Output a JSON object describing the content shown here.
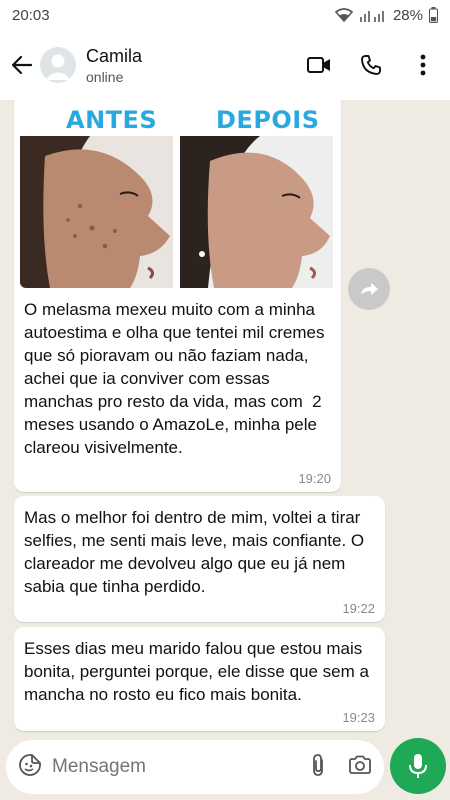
{
  "status_bar": {
    "time": "20:03",
    "battery": "28%"
  },
  "header": {
    "contact_name": "Camila",
    "contact_status": "online"
  },
  "messages": [
    {
      "type": "image",
      "image_labels": {
        "before": "ANTES",
        "after": "DEPOIS"
      },
      "caption": "O melasma mexeu muito com a minha autoestima e olha que tentei mil cremes que só pioravam ou não faziam nada, achei que ia conviver com essas manchas pro resto da vida, mas com  2 meses usando o AmazoLe, minha pele clareou visivelmente.",
      "time": "19:20"
    },
    {
      "type": "text",
      "text": "Mas o melhor foi dentro de mim, voltei a tirar selfies, me senti mais leve, mais confiante. O clareador me devolveu algo que eu já nem sabia que tinha perdido.",
      "time": "19:22"
    },
    {
      "type": "text",
      "text": "Esses dias meu marido falou que estou mais bonita, perguntei porque, ele disse que sem a mancha no rosto eu fico mais bonita.",
      "time": "19:23"
    }
  ],
  "composer": {
    "placeholder": "Mensagem"
  },
  "colors": {
    "accent_green": "#1fa855",
    "label_blue": "#2aa8e0",
    "chat_bg": "#efeae2"
  }
}
